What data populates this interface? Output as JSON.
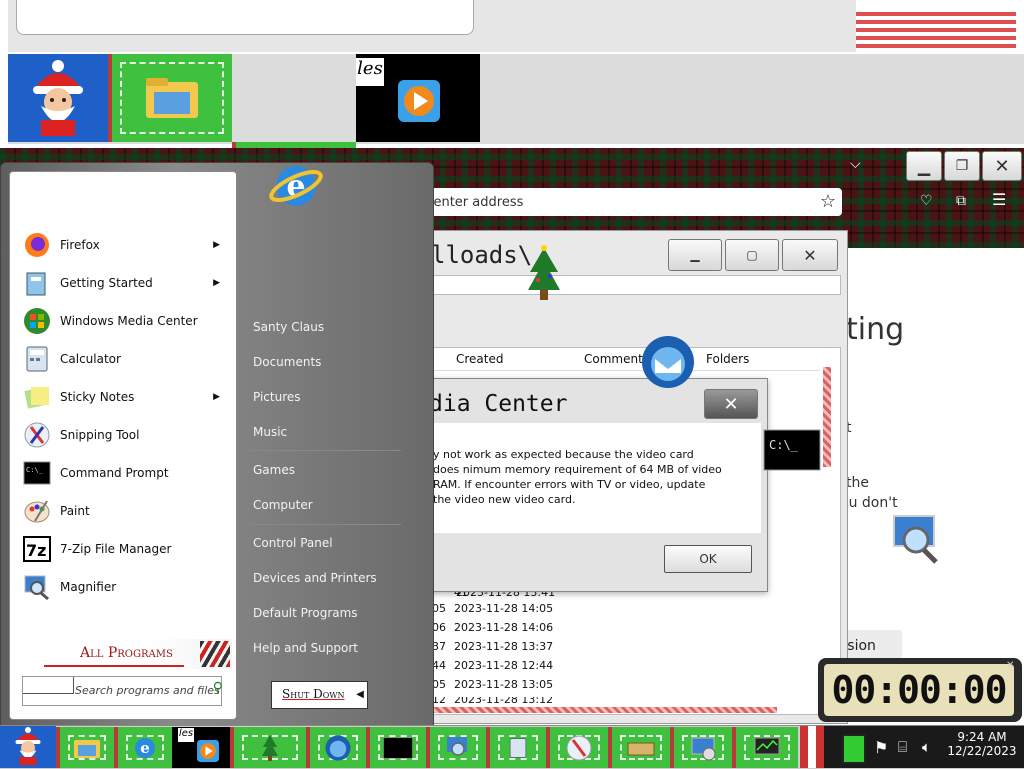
{
  "top_dock": {
    "icons": [
      "santa-icon",
      "file-explorer-icon",
      "internet-explorer-icon",
      "media-player-icon",
      "christmas-tree-icon",
      "thunderbird-icon",
      "command-prompt-icon",
      "magnifier-icon",
      "partial-icon"
    ],
    "media_player_label": "les"
  },
  "browser": {
    "address_placeholder": "r enter address",
    "window_controls": [
      "minimize",
      "maximize",
      "close"
    ],
    "page_partial_heading": "ting",
    "page_partial_text_1": "t",
    "page_partial_text_2": "the",
    "page_partial_text_3": "ou don't",
    "page_partial_button": "ssion"
  },
  "explorer": {
    "title_partial": "lloads\\",
    "columns": [
      "Created",
      "Comment",
      "Folders"
    ],
    "rows": [
      {
        "prefix": "41",
        "created": "2023-11-28 13:41"
      },
      {
        "prefix": "05",
        "created": "2023-11-28 14:05"
      },
      {
        "prefix": "06",
        "created": "2023-11-28 14:06"
      },
      {
        "prefix": "37",
        "created": "2023-11-28 13:37"
      },
      {
        "prefix": "44",
        "created": "2023-11-28 12:44"
      },
      {
        "prefix": "05",
        "created": "2023-11-28 13:05"
      },
      {
        "prefix": "12",
        "created": "2023-11-28 13:12"
      }
    ]
  },
  "dialog": {
    "title_partial": "dia Center",
    "message": "y not work as expected because the video card does nimum memory requirement of 64 MB of video RAM. If encounter errors with TV or video, update the video new video card.",
    "ok_label": "OK"
  },
  "start_menu": {
    "left_items": [
      {
        "label": "Firefox",
        "icon": "firefox-icon",
        "submenu": true
      },
      {
        "label": "Getting Started",
        "icon": "getting-started-icon",
        "submenu": true
      },
      {
        "label": "Windows Media Center",
        "icon": "windows-media-center-icon",
        "submenu": false
      },
      {
        "label": "Calculator",
        "icon": "calculator-icon",
        "submenu": false
      },
      {
        "label": "Sticky Notes",
        "icon": "sticky-notes-icon",
        "submenu": true
      },
      {
        "label": "Snipping Tool",
        "icon": "snipping-tool-icon",
        "submenu": false
      },
      {
        "label": "Command Prompt",
        "icon": "command-prompt-icon",
        "submenu": false
      },
      {
        "label": "Paint",
        "icon": "paint-icon",
        "submenu": false
      },
      {
        "label": "7-Zip File Manager",
        "icon": "7zip-icon",
        "submenu": false
      },
      {
        "label": "Magnifier",
        "icon": "magnifier-icon",
        "submenu": false
      }
    ],
    "all_programs": "All Programs",
    "search_placeholder": "Search programs and files",
    "right_items": [
      "Santy Claus",
      "Documents",
      "Pictures",
      "Music",
      "Games",
      "Computer",
      "Control Panel",
      "Devices and Printers",
      "Default Programs",
      "Help and Support"
    ],
    "shutdown_label": "Shut Down"
  },
  "timer": {
    "display": "00:00:00"
  },
  "taskbar": {
    "icons": [
      "start-orb-icon",
      "file-explorer-icon",
      "internet-explorer-icon",
      "media-player-icon",
      "christmas-tree-icon",
      "thunderbird-icon",
      "command-prompt-icon",
      "magnifier-icon",
      "calculator-icon",
      "snipping-tool-icon",
      "7zip-icon",
      "remote-desktop-icon",
      "system-monitor-icon"
    ],
    "media_label": "les",
    "clock_time": "9:24 AM",
    "clock_date": "12/22/2023"
  },
  "colors": {
    "tile_green": "#3fc13f",
    "tile_red": "#b83b3b",
    "menu_left_bg": "#ffffff",
    "menu_right_bg": "#6f6f6f",
    "timer_bg": "#e8e0b8"
  }
}
